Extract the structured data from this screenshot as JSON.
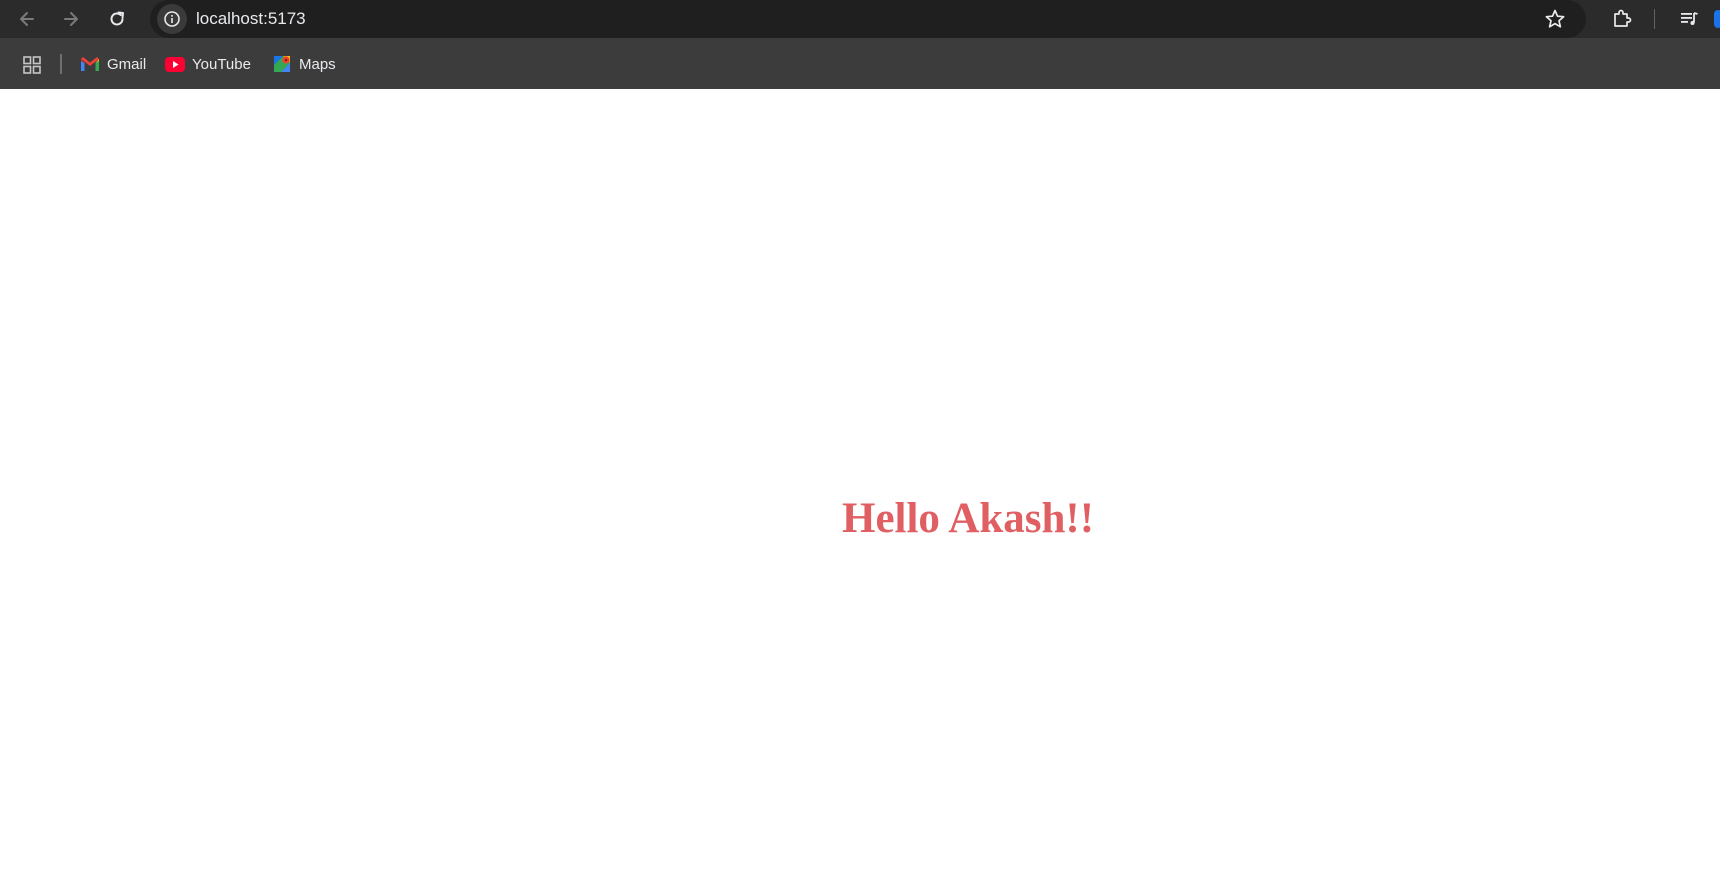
{
  "browser": {
    "url": "localhost:5173",
    "icons": {
      "back": "arrow-left-icon",
      "forward": "arrow-right-icon",
      "reload": "reload-icon",
      "site_info": "info-circle-icon",
      "bookmark_star": "star-outline-icon",
      "extensions": "puzzle-icon",
      "media": "media-queue-icon",
      "apps": "grid-icon"
    },
    "bookmarks": [
      {
        "label": "Gmail",
        "icon": "gmail-icon"
      },
      {
        "label": "YouTube",
        "icon": "youtube-icon"
      },
      {
        "label": "Maps",
        "icon": "maps-icon"
      }
    ]
  },
  "page": {
    "heading": "Hello Akash!!",
    "heading_color": "#df5f63"
  },
  "colors": {
    "chrome_toolbar": "#2b2b2b",
    "bookmarks_bar": "#3c3c3c",
    "omnibox": "#1f1f1f",
    "page_background": "#ffffff"
  }
}
